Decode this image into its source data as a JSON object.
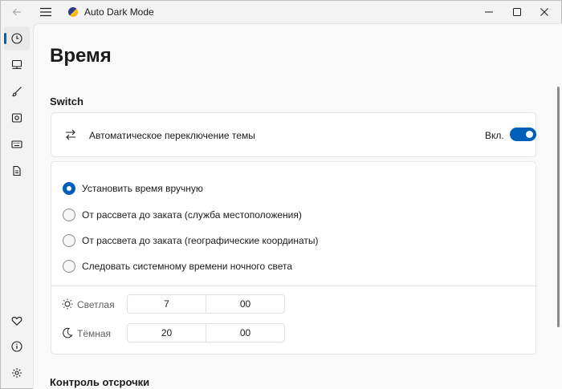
{
  "app": {
    "title": "Auto Dark Mode"
  },
  "titlebar": {
    "minimize": "—",
    "maximize": "☐",
    "close": "✕"
  },
  "nav": {
    "items": [
      {
        "name": "time",
        "icon": "clock-icon",
        "active": true
      },
      {
        "name": "apps",
        "icon": "monitor-icon"
      },
      {
        "name": "personalization",
        "icon": "brush-icon"
      },
      {
        "name": "wallpaper",
        "icon": "picture-settings-icon"
      },
      {
        "name": "hotkeys",
        "icon": "keyboard-icon"
      },
      {
        "name": "scripts",
        "icon": "document-icon"
      }
    ],
    "bottom": [
      {
        "name": "donate",
        "icon": "heart-icon"
      },
      {
        "name": "about",
        "icon": "info-icon"
      },
      {
        "name": "settings",
        "icon": "gear-icon"
      }
    ]
  },
  "page": {
    "title": "Время"
  },
  "switch_section": {
    "title": "Switch",
    "auto_label": "Автоматическое переключение темы",
    "toggle_text": "Вкл.",
    "toggle_on": true
  },
  "mode_options": [
    {
      "label": "Установить время вручную",
      "checked": true
    },
    {
      "label": "От рассвета до заката (служба местоположения)",
      "checked": false
    },
    {
      "label": "От рассвета до заката (географические координаты)",
      "checked": false
    },
    {
      "label": "Следовать системному времени ночного света",
      "checked": false
    }
  ],
  "times": {
    "light": {
      "label": "Светлая",
      "hour": "7",
      "minute": "00",
      "icon": "sun-icon"
    },
    "dark": {
      "label": "Тёмная",
      "hour": "20",
      "minute": "00",
      "icon": "moon-icon"
    }
  },
  "postpone_section": {
    "title": "Контроль отсрочки"
  },
  "colors": {
    "accent": "#005fb8",
    "window_bg": "#f3f3f3",
    "content_bg": "#f9f9f9",
    "card_bg": "#ffffff"
  }
}
